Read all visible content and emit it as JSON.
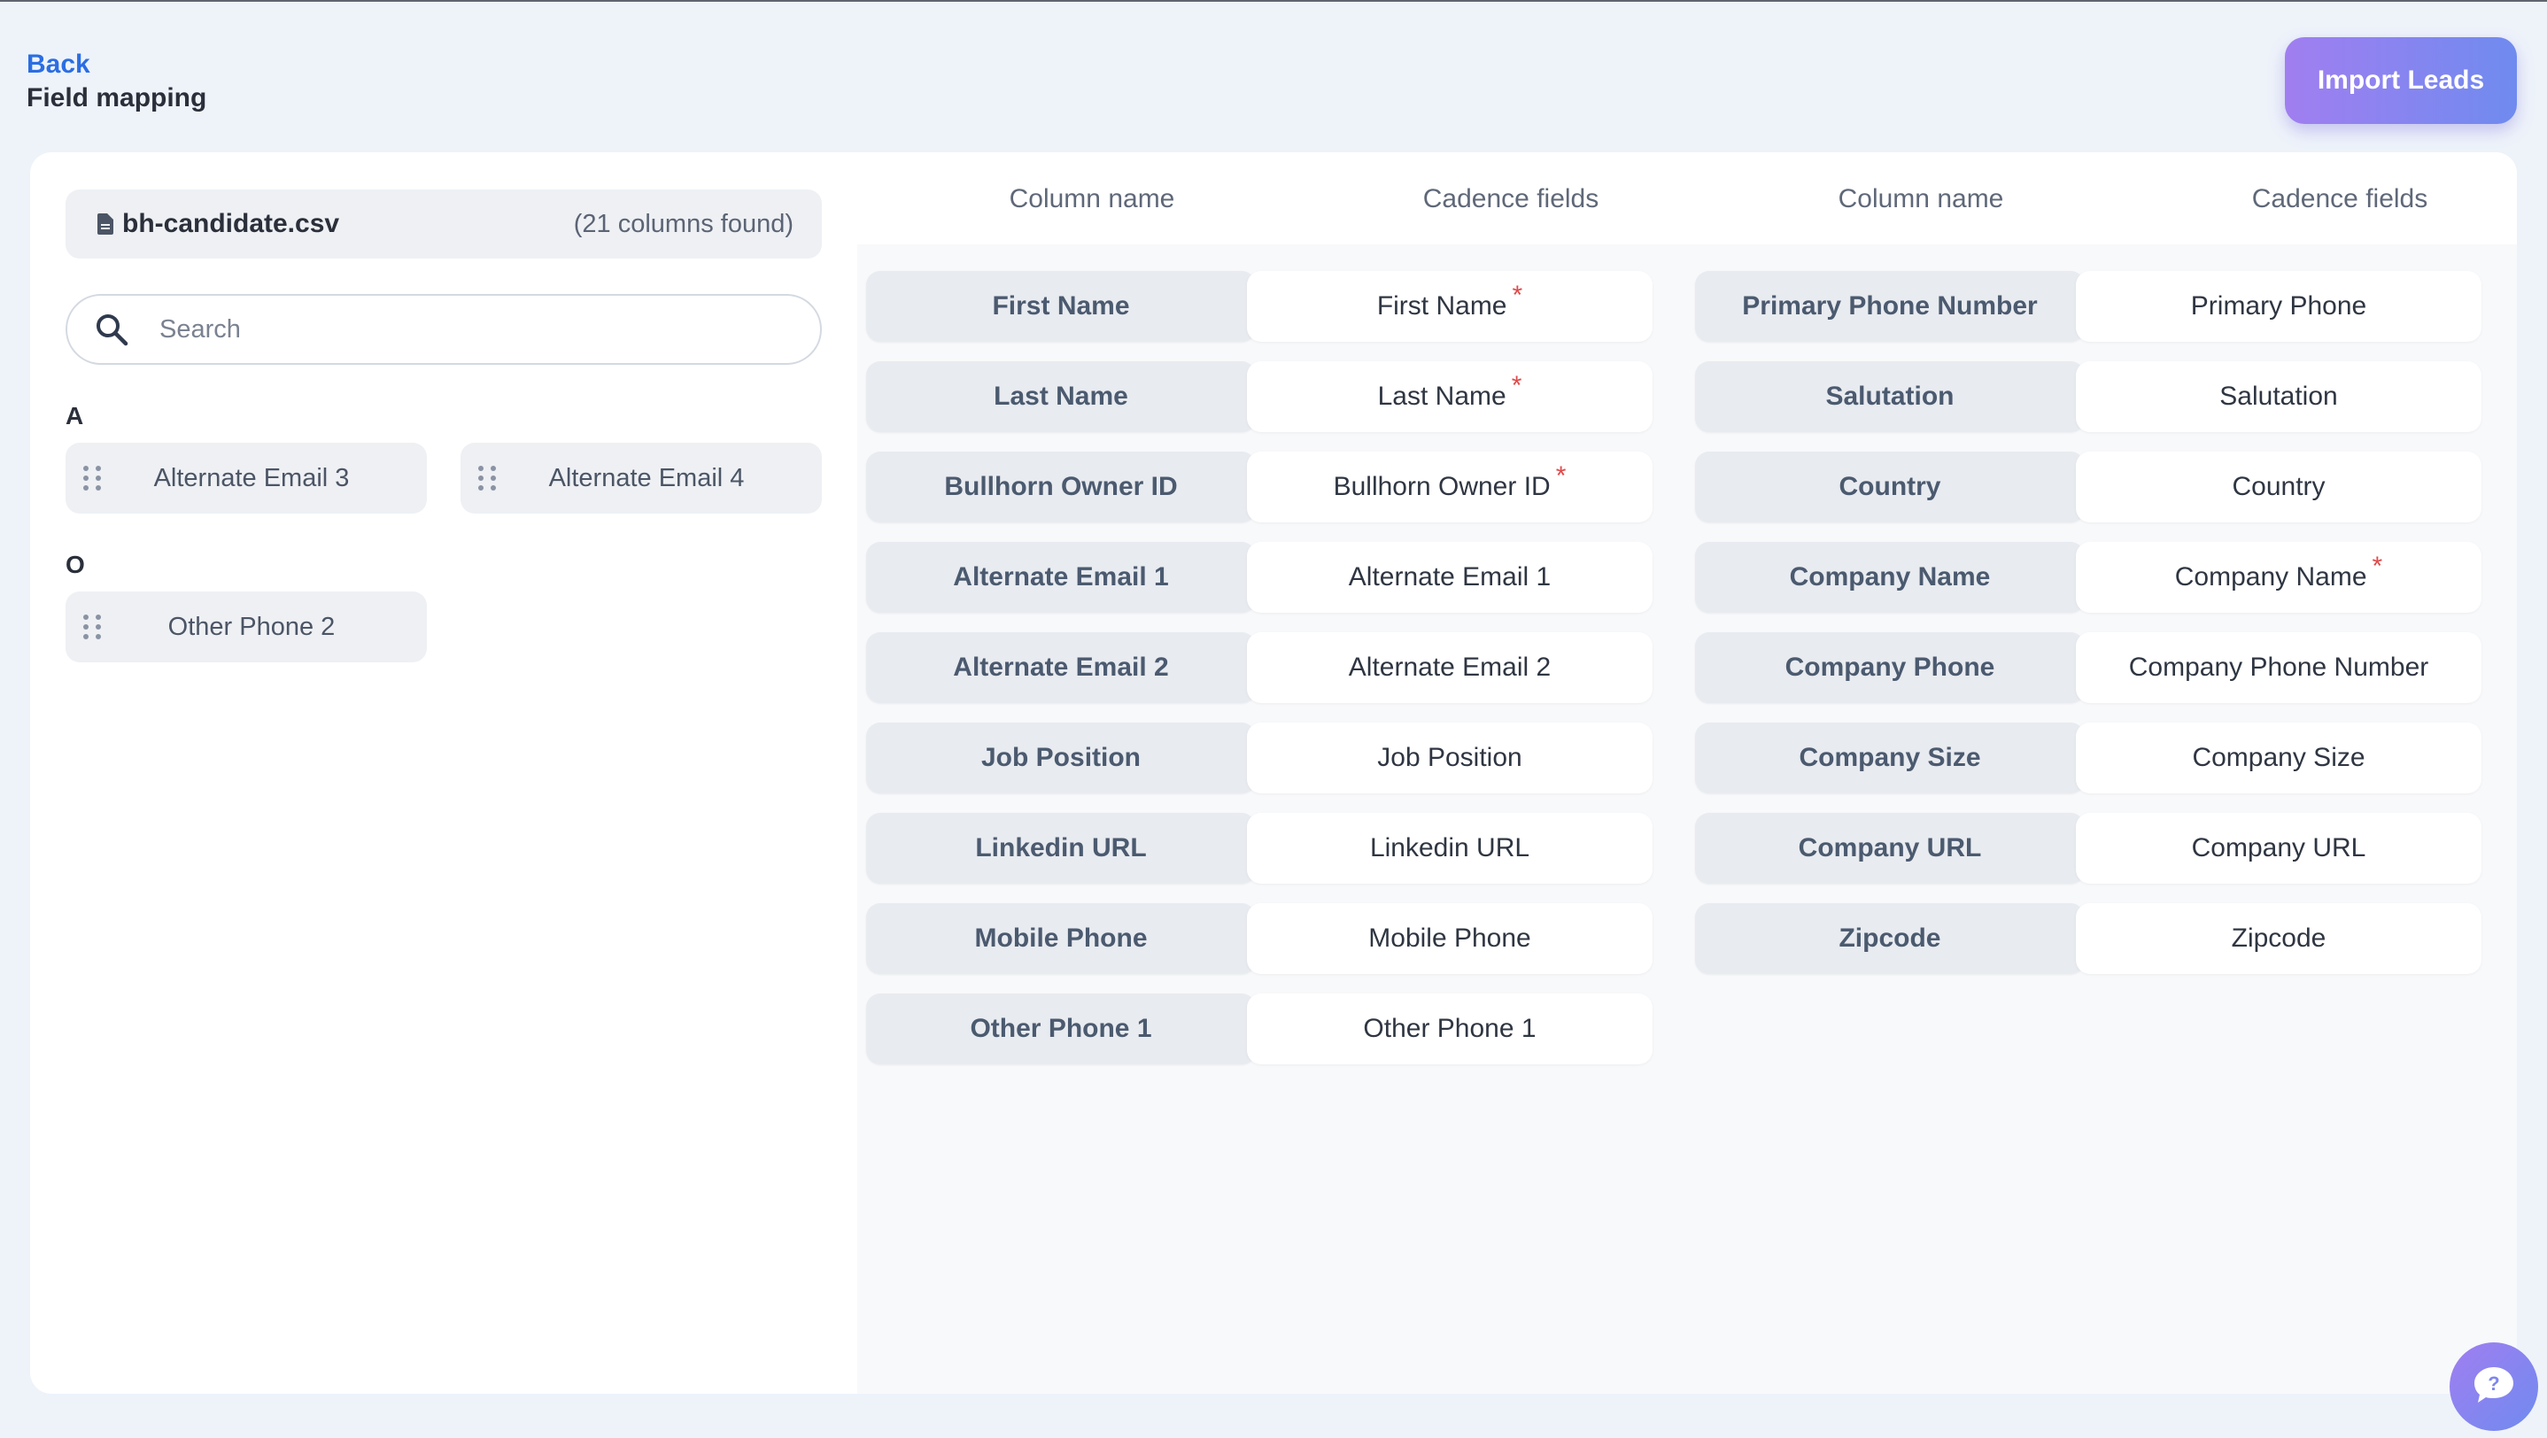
{
  "header": {
    "back_label": "Back",
    "title": "Field mapping"
  },
  "actions": {
    "import_label": "Import Leads"
  },
  "file": {
    "name": "bh-candidate.csv",
    "columns_found": "(21 columns found)"
  },
  "search": {
    "placeholder": "Search",
    "value": ""
  },
  "unmapped": [
    {
      "letter": "A",
      "items": [
        "Alternate Email 3",
        "Alternate Email 4"
      ]
    },
    {
      "letter": "O",
      "items": [
        "Other Phone 2"
      ]
    }
  ],
  "table_headers": [
    "Column name",
    "Cadence fields",
    "Column name",
    "Cadence fields"
  ],
  "mappings_left": [
    {
      "column": "First Name",
      "field": "First Name",
      "required": "*"
    },
    {
      "column": "Last Name",
      "field": "Last Name",
      "required": "*"
    },
    {
      "column": "Bullhorn Owner ID",
      "field": "Bullhorn Owner ID",
      "required": "*"
    },
    {
      "column": "Alternate Email 1",
      "field": "Alternate Email 1",
      "required": ""
    },
    {
      "column": "Alternate Email 2",
      "field": "Alternate Email 2",
      "required": ""
    },
    {
      "column": "Job Position",
      "field": "Job Position",
      "required": ""
    },
    {
      "column": "Linkedin URL",
      "field": "Linkedin URL",
      "required": ""
    },
    {
      "column": "Mobile Phone",
      "field": "Mobile Phone",
      "required": ""
    },
    {
      "column": "Other Phone 1",
      "field": "Other Phone 1",
      "required": ""
    }
  ],
  "mappings_right": [
    {
      "column": "Primary Phone Number",
      "field": "Primary Phone",
      "required": ""
    },
    {
      "column": "Salutation",
      "field": "Salutation",
      "required": ""
    },
    {
      "column": "Country",
      "field": "Country",
      "required": ""
    },
    {
      "column": "Company Name",
      "field": "Company Name",
      "required": "*"
    },
    {
      "column": "Company Phone",
      "field": "Company Phone Number",
      "required": ""
    },
    {
      "column": "Company Size",
      "field": "Company Size",
      "required": ""
    },
    {
      "column": "Company URL",
      "field": "Company URL",
      "required": ""
    },
    {
      "column": "Zipcode",
      "field": "Zipcode",
      "required": ""
    }
  ],
  "colors": {
    "accent": "#2b6de3",
    "gradient_start": "#a17ef0",
    "gradient_end": "#6f8bef",
    "required": "#e0494a"
  },
  "icons": {
    "file": "file-icon",
    "search": "search-icon",
    "grip": "drag-handle-icon",
    "help": "help-chat-icon"
  }
}
